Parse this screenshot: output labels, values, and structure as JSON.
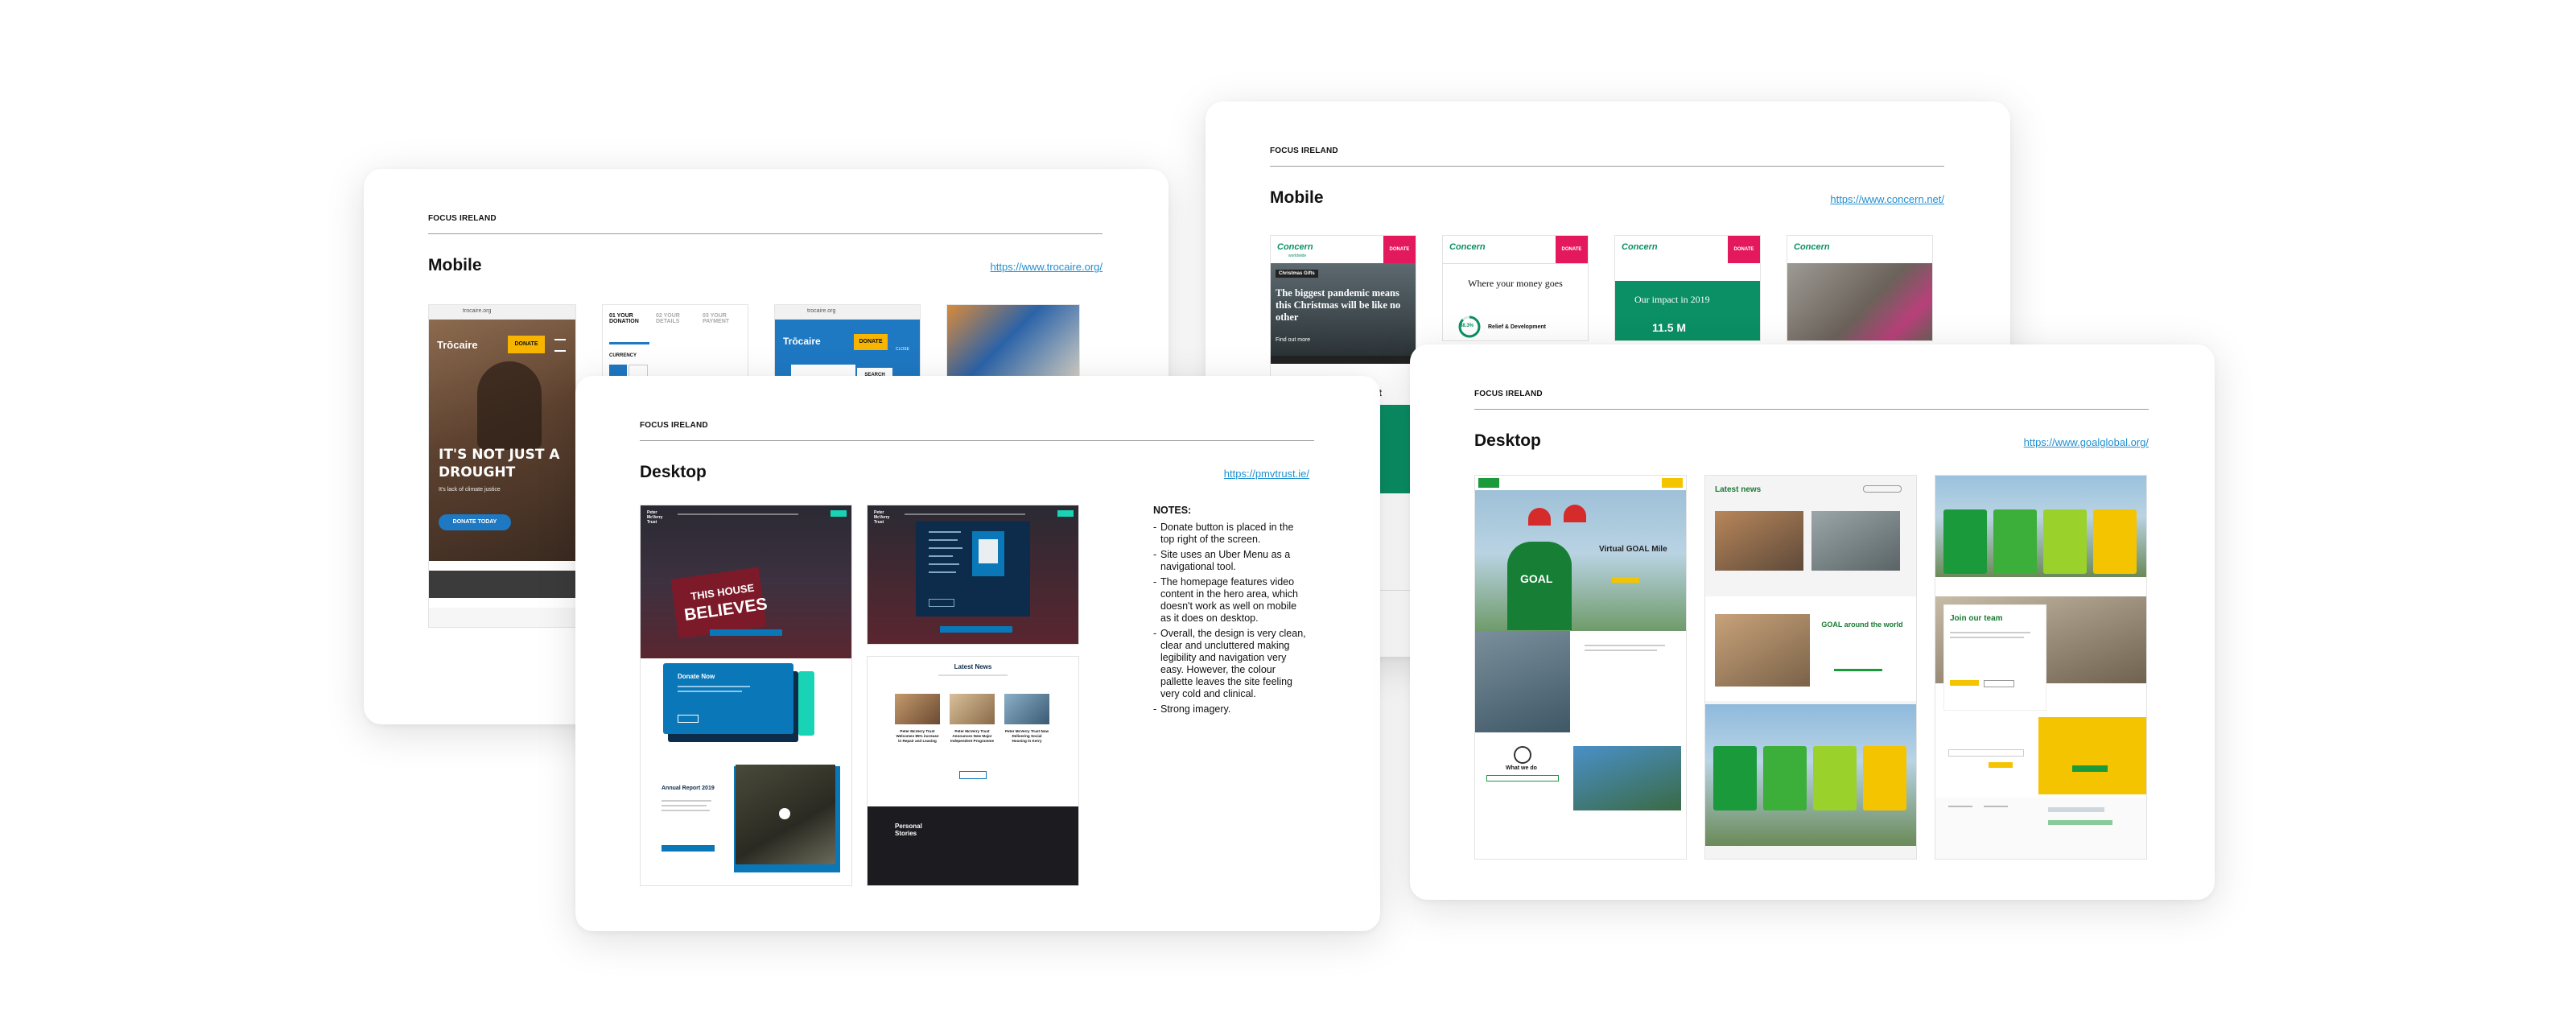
{
  "boards": {
    "trocaire": {
      "eyebrow": "FOCUS IRELAND",
      "heading": "Mobile",
      "link": "https://www.trocaire.org/",
      "screens": {
        "url": "trocaire.org",
        "logo": "Trōcaire",
        "donate": "DONATE",
        "hero_line1": "IT'S NOT JUST A",
        "hero_line2": "DROUGHT",
        "hero_sub": "It's lack of climate justice",
        "donate_today": "DONATE TODAY",
        "step1": "01 YOUR DONATION",
        "step2": "02 YOUR DETAILS",
        "step3": "03 YOUR PAYMENT",
        "currency": "CURRENCY",
        "close": "CLOSE",
        "search": "SEARCH"
      }
    },
    "concern": {
      "eyebrow": "FOCUS IRELAND",
      "heading": "Mobile",
      "link": "https://www.concern.net/",
      "screens": {
        "logo": "Concern",
        "logo_sub": "worldwide",
        "donate": "DONATE",
        "gifts": "Christmas Gifts",
        "headline": "The biggest pandemic means this Christmas will be like no other",
        "find_out": "Find out more",
        "money_title": "Where your money goes",
        "percent": "88.3%",
        "relief": "Relief & Development",
        "impact": "Our impact in 2019",
        "impact_num": "11.5 M",
        "under_fragment": "ort"
      }
    },
    "pmv": {
      "eyebrow": "FOCUS IRELAND",
      "heading": "Desktop",
      "link": "https://pmvtrust.ie/",
      "notes_title": "NOTES:",
      "notes": [
        "Donate button is placed in the top right of the screen.",
        "Site uses an Uber Menu as a navigational tool.",
        "The homepage features video content in the hero area, which doesn't work as well on mobile as it does on desktop.",
        "Overall, the design is very clean, clear and uncluttered making legibility and navigation very easy. However, the colour pallette leaves the site feeling very cold and clinical.",
        "Strong imagery."
      ],
      "screens": {
        "logo": "Peter McVerry Trust",
        "sign_line1": "THIS HOUSE",
        "sign_line2": "BELIEVES",
        "donate_now": "Donate Now",
        "annual_report": "Annual Report 2019",
        "latest_news": "Latest News",
        "news_items": [
          "Peter McVerry Trust Welcomes 85% increase in Repair and Leasing",
          "Peter McVerry Trust Announces New Major Independent Programme",
          "Peter McVerry Trust Now Delivering Social Housing in Kerry"
        ],
        "personal_stories": "Personal Stories"
      }
    },
    "goal": {
      "eyebrow": "FOCUS IRELAND",
      "heading": "Desktop",
      "link": "https://www.goalglobal.org/",
      "screens": {
        "hero_title": "Virtual GOAL Mile",
        "what_we_do": "What we do",
        "latest_news": "Latest news",
        "goal_around": "GOAL around the world",
        "join_team": "Join our team",
        "shirt_text": "GOAL"
      }
    }
  },
  "colors": {
    "pmv_navy": "#0d2b4a",
    "pmv_blue": "#0a78b8",
    "pmv_teal": "#19d3b5",
    "trocaire_yellow": "#f7b500",
    "trocaire_blue": "#1e78c2",
    "concern_green": "#0b8f64",
    "concern_pink": "#e3185d",
    "goal_green": "#1a9a3b",
    "goal_lime": "#9ad12a",
    "goal_yellow": "#f5c400"
  }
}
